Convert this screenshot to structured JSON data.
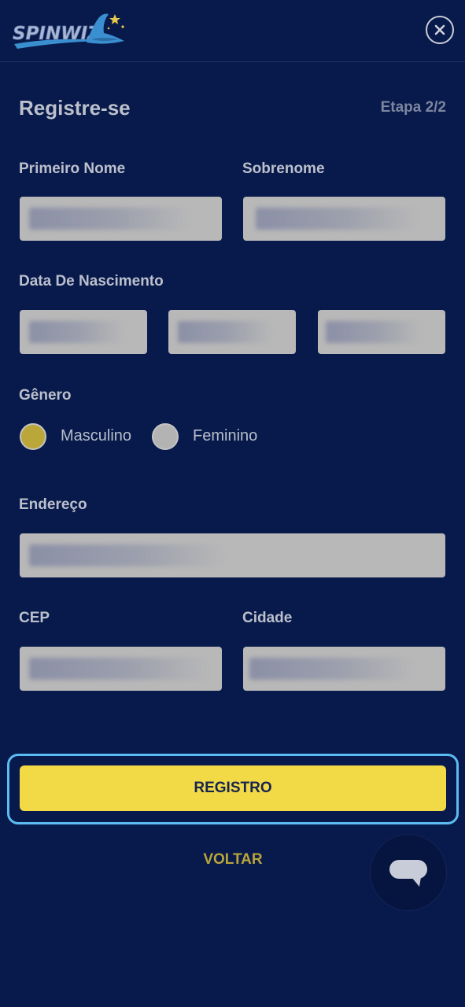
{
  "brand": {
    "logo_text": "SPINWIZ",
    "hat_color": "#3a8fd0",
    "star_color": "#e6c94a"
  },
  "header": {
    "close_icon": "close-icon"
  },
  "form": {
    "title": "Registre-se",
    "step": "Etapa 2/2",
    "first_name_label": "Primeiro Nome",
    "last_name_label": "Sobrenome",
    "dob_label": "Data De Nascimento",
    "gender_label": "Gênero",
    "gender_options": [
      "Masculino",
      "Feminino"
    ],
    "gender_selected": "Masculino",
    "address_label": "Endereço",
    "zip_label": "CEP",
    "city_label": "Cidade"
  },
  "actions": {
    "register_label": "REGISTRO",
    "back_label": "VOLTAR"
  },
  "chat": {
    "icon": "chat-bubble-icon"
  },
  "colors": {
    "background": "#081a4b",
    "primary_button": "#f2da46",
    "focus_ring": "#5cbcf2",
    "selected_radio": "#bba63a",
    "link": "#b9a53b"
  }
}
